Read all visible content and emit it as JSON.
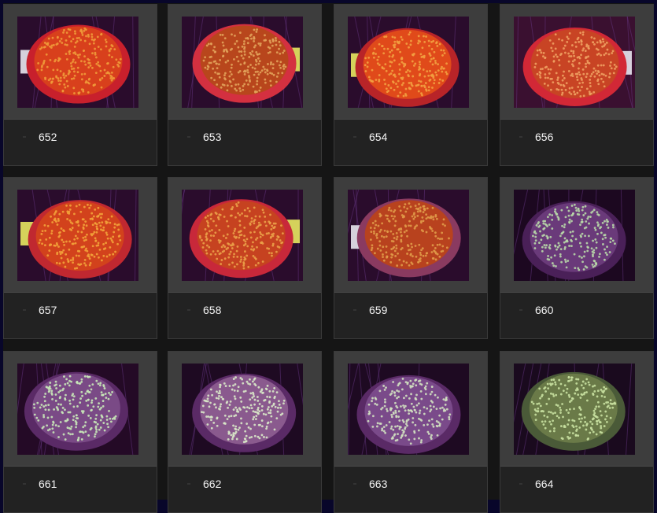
{
  "gallery": {
    "items": [
      {
        "label": "652",
        "photo": "orange-coral-photo",
        "bg": "#2a0c2c",
        "coral": "#d8401c",
        "polyp": "#f09a3a",
        "rim": "#c8202c",
        "tag": true
      },
      {
        "label": "653",
        "photo": "orange-coral-photo",
        "bg": "#2a0c2c",
        "coral": "#b8461c",
        "polyp": "#e2a25a",
        "rim": "#d43040",
        "tag": true
      },
      {
        "label": "654",
        "photo": "orange-coral-photo",
        "bg": "#2a0c2c",
        "coral": "#e04a1a",
        "polyp": "#f2a040",
        "rim": "#b82428",
        "tag": true
      },
      {
        "label": "656",
        "photo": "orange-coral-photo",
        "bg": "#3a1030",
        "coral": "#c84424",
        "polyp": "#eea060",
        "rim": "#d22836",
        "tag": true
      },
      {
        "label": "657",
        "photo": "orange-coral-photo",
        "bg": "#2a0c2c",
        "coral": "#d2421c",
        "polyp": "#f2a23a",
        "rim": "#c02830",
        "tag": true
      },
      {
        "label": "658",
        "photo": "orange-coral-photo",
        "bg": "#2a0c2c",
        "coral": "#c64220",
        "polyp": "#eaa048",
        "rim": "#c8283a",
        "tag": true
      },
      {
        "label": "659",
        "photo": "orange-coral-photo",
        "bg": "#2a0c2c",
        "coral": "#b8421e",
        "polyp": "#e09a48",
        "rim": "#8a3a60",
        "tag": true
      },
      {
        "label": "660",
        "photo": "green-purple-coral-photo",
        "bg": "#1c0820",
        "coral": "#6a3a7a",
        "polyp": "#b8d8a8",
        "rim": "#4a2058",
        "tag": false
      },
      {
        "label": "661",
        "photo": "green-purple-coral-photo",
        "bg": "#240a26",
        "coral": "#7a4a86",
        "polyp": "#c8e8b8",
        "rim": "#5a2a66",
        "tag": false
      },
      {
        "label": "662",
        "photo": "green-purple-coral-photo",
        "bg": "#1e0a22",
        "coral": "#8a5a8e",
        "polyp": "#d8e8c8",
        "rim": "#5a2a66",
        "tag": false
      },
      {
        "label": "663",
        "photo": "green-purple-coral-photo",
        "bg": "#1e0a22",
        "coral": "#7a4a8a",
        "polyp": "#d0e0c0",
        "rim": "#5a2a66",
        "tag": false
      },
      {
        "label": "664",
        "photo": "green-purple-coral-photo",
        "bg": "#1a0a1e",
        "coral": "#6a7a48",
        "polyp": "#c8e0a0",
        "rim": "#4a5a38",
        "tag": false
      }
    ]
  }
}
